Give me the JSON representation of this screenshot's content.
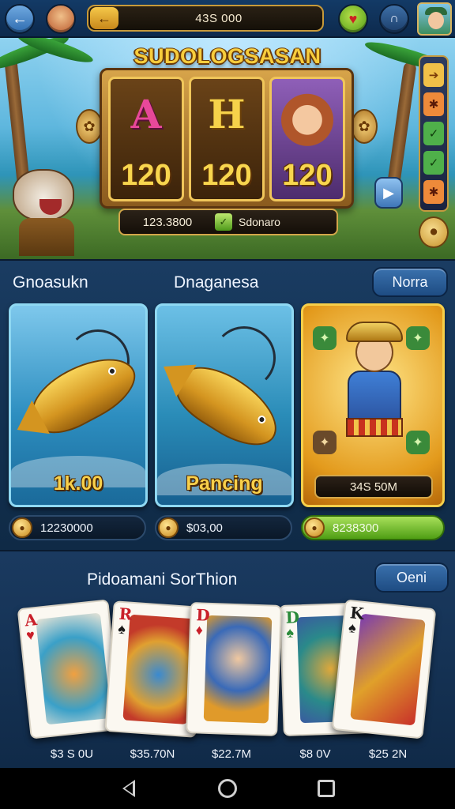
{
  "topbar": {
    "coin_amount": "43S 000",
    "back_icon": "arrow-left-icon",
    "heart_icon": "heart-icon",
    "lock_icon": "lock-icon"
  },
  "hero": {
    "title": "SUDOLOGSASAN",
    "reels": [
      {
        "symbol": "A",
        "value": "120"
      },
      {
        "symbol": "H",
        "value": "120"
      },
      {
        "symbol": "",
        "value": "120"
      }
    ],
    "win_value": "123.3800",
    "win_label": "Sdonaro"
  },
  "games": {
    "label_left": "Gnoasukn",
    "label_mid": "Dnaganesa",
    "more_button": "Norra",
    "cards": [
      {
        "caption": "1k.00",
        "coins": "12230000"
      },
      {
        "caption": "Pancing",
        "coins": "$03,00"
      },
      {
        "price": "34S 50M",
        "coins": "8238300"
      }
    ]
  },
  "cards_section": {
    "title": "Pidoamani SorThion",
    "open_button": "Oeni",
    "cards": [
      {
        "rank": "A",
        "suit": "♥",
        "color": "red",
        "price": "$3 S 0U"
      },
      {
        "rank": "R",
        "suit": "♠",
        "color": "red",
        "price": "$35.70N"
      },
      {
        "rank": "D",
        "suit": "♦",
        "color": "red",
        "price": "$22.7M"
      },
      {
        "rank": "D",
        "suit": "♠",
        "color": "green",
        "price": "$8 0V"
      },
      {
        "rank": "K",
        "suit": "♠",
        "color": "black",
        "price": "$25 2N"
      }
    ]
  },
  "colors": {
    "accent_gold": "#f7cd3c",
    "panel_blue": "#1a3c62",
    "win_green": "#4f9e14"
  }
}
